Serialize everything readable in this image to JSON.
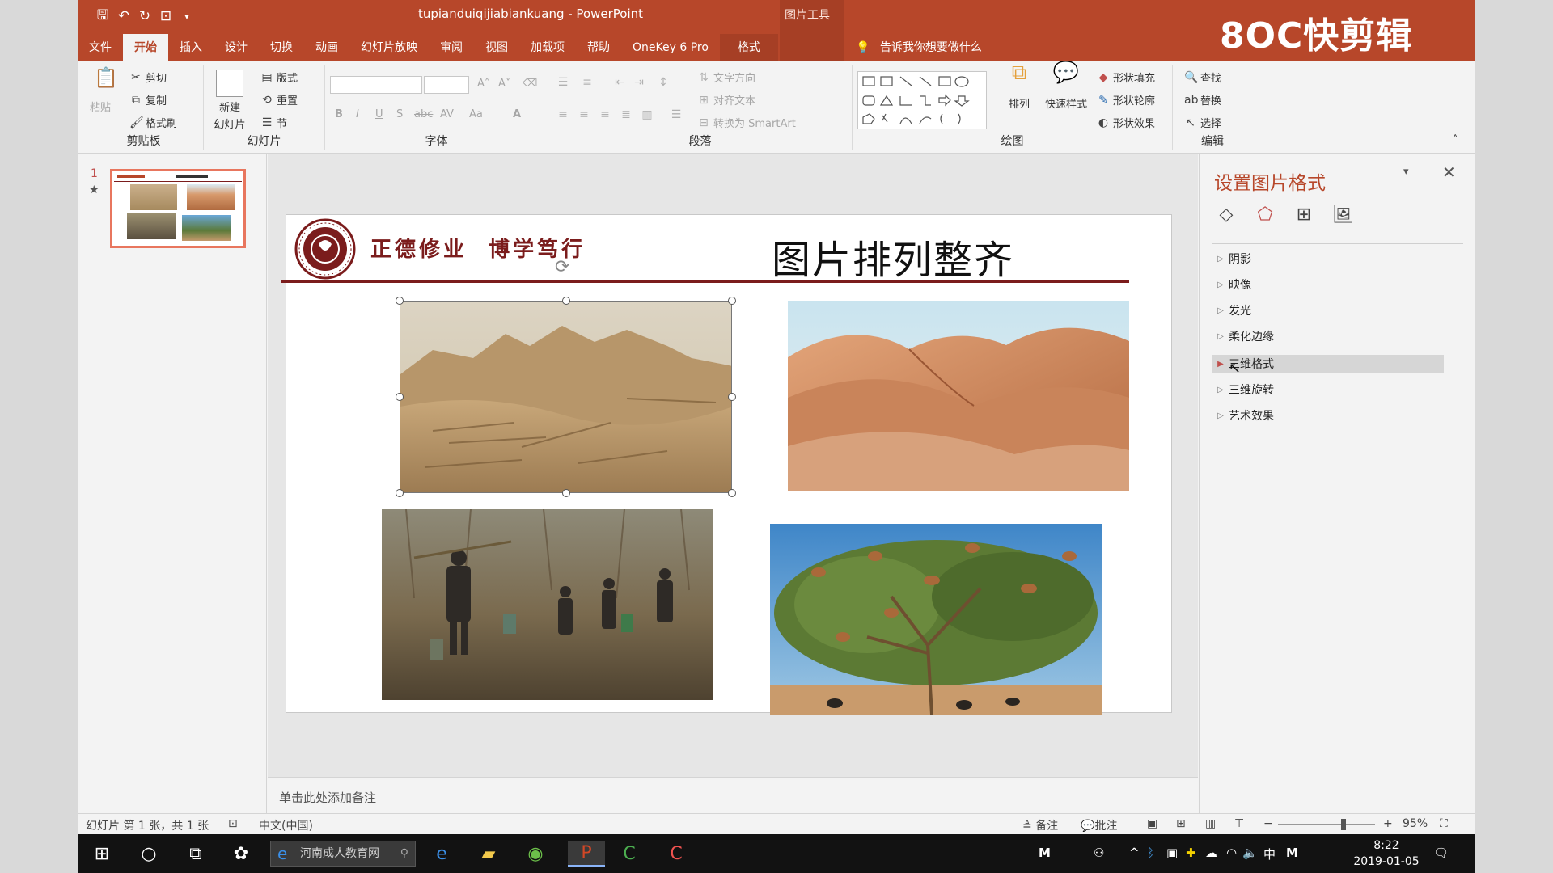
{
  "app": {
    "doc_title": "tupianduiqijiabiankuang  -  PowerPoint",
    "tool_group": "图片工具",
    "watermark": "8OC快剪辑"
  },
  "tabs": [
    "文件",
    "开始",
    "插入",
    "设计",
    "切换",
    "动画",
    "幻灯片放映",
    "审阅",
    "视图",
    "加载项",
    "帮助",
    "OneKey 6 Pro",
    "格式"
  ],
  "tell_me": "告诉我你想要做什么",
  "ribbon": {
    "clipboard": {
      "paste": "粘贴",
      "cut": "剪切",
      "copy": "复制",
      "format_painter": "格式刷",
      "label": "剪贴板"
    },
    "slides": {
      "new_slide_1": "新建",
      "new_slide_2": "幻灯片",
      "layout": "版式",
      "reset": "重置",
      "section": "节",
      "label": "幻灯片"
    },
    "font": {
      "label": "字体",
      "bold": "B",
      "italic": "I",
      "underline": "U",
      "shadow": "S",
      "strike": "abc",
      "spacing": "AV",
      "case": "Aa",
      "color": "A"
    },
    "paragraph": {
      "text_direction": "文字方向",
      "align_text": "对齐文本",
      "smartart": "转换为 SmartArt",
      "label": "段落"
    },
    "drawing": {
      "arrange": "排列",
      "quick_styles": "快速样式",
      "shape_fill": "形状填充",
      "shape_outline": "形状轮廓",
      "shape_effects": "形状效果",
      "label": "绘图"
    },
    "editing": {
      "find": "查找",
      "replace": "替换",
      "select": "选择",
      "label": "编辑"
    }
  },
  "thumbs": {
    "slide_number": "1",
    "star": "★"
  },
  "slide": {
    "motto": "正德修业  博学笃行",
    "title": "图片排列整齐",
    "accent_color": "#7b1c1c"
  },
  "notes_placeholder": "单击此处添加备注",
  "format_pane": {
    "title": "设置图片格式",
    "items": [
      "阴影",
      "映像",
      "发光",
      "柔化边缘",
      "三维格式",
      "三维旋转",
      "艺术效果"
    ],
    "highlighted_index": 4
  },
  "statusbar": {
    "slide_info": "幻灯片 第 1 张，共 1 张",
    "language": "中文(中国)",
    "notes": "备注",
    "comments": "批注",
    "zoom": "95%"
  },
  "taskbar": {
    "search_text": "河南成人教育网",
    "ime": "中",
    "ime2": "M",
    "time": "8:22",
    "date": "2019-01-05"
  },
  "colors": {
    "ppt_red": "#b7472a",
    "taskbar": "#121212"
  }
}
